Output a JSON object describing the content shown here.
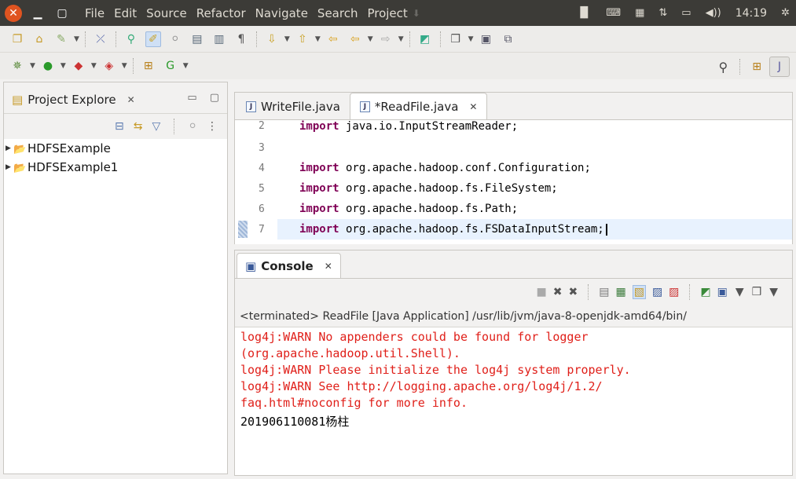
{
  "menubar": {
    "items": [
      "File",
      "Edit",
      "Source",
      "Refactor",
      "Navigate",
      "Search",
      "Project"
    ],
    "clock": "14:19"
  },
  "explorer": {
    "title": "Project Explore",
    "projects": [
      "HDFSExample",
      "HDFSExample1"
    ]
  },
  "editor": {
    "tabs": [
      {
        "label": "WriteFile.java",
        "active": false
      },
      {
        "label": "*ReadFile.java",
        "active": true
      }
    ],
    "lines": [
      {
        "num": "2",
        "kw": "import",
        "text": " java.io.InputStreamReader;"
      },
      {
        "num": "3",
        "kw": "",
        "text": ""
      },
      {
        "num": "4",
        "kw": "import",
        "text": " org.apache.hadoop.conf.Configuration;"
      },
      {
        "num": "5",
        "kw": "import",
        "text": " org.apache.hadoop.fs.FileSystem;"
      },
      {
        "num": "6",
        "kw": "import",
        "text": " org.apache.hadoop.fs.Path;"
      },
      {
        "num": "7",
        "kw": "import",
        "text": " org.apache.hadoop.fs.FSDataInputStream;"
      }
    ]
  },
  "console": {
    "tab_label": "Console",
    "title": "<terminated> ReadFile [Java Application] /usr/lib/jvm/java-8-openjdk-amd64/bin/",
    "output": [
      {
        "text": "log4j:WARN No appenders could be found for logger",
        "type": "err"
      },
      {
        "text": "(org.apache.hadoop.util.Shell).",
        "type": "err"
      },
      {
        "text": "log4j:WARN Please initialize the log4j system properly.",
        "type": "err"
      },
      {
        "text": "log4j:WARN See http://logging.apache.org/log4j/1.2/",
        "type": "err"
      },
      {
        "text": "faq.html#noconfig for more info.",
        "type": "err"
      },
      {
        "text": "201906110081杨柱",
        "type": "out"
      }
    ]
  },
  "colors": {
    "keyword": "#7f0055",
    "error": "#e0201a",
    "menubar": "#3c3b37",
    "close_button": "#e05420"
  }
}
